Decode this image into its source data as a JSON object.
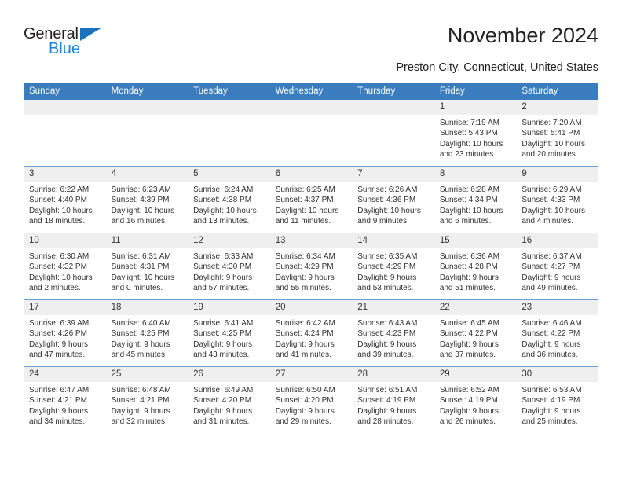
{
  "brand": {
    "name_top": "General",
    "name_bottom": "Blue",
    "color_dark": "#231f20",
    "color_blue": "#1b87dc",
    "triangle_color": "#1b74bb"
  },
  "header": {
    "title": "November 2024",
    "subtitle": "Preston City, Connecticut, United States"
  },
  "theme": {
    "header_bg": "#3a7cbe",
    "header_text": "#ffffff",
    "daynum_bg": "#efefef",
    "row_divider": "#6e9fd0",
    "body_text": "#333333"
  },
  "calendar": {
    "weekdays": [
      "Sunday",
      "Monday",
      "Tuesday",
      "Wednesday",
      "Thursday",
      "Friday",
      "Saturday"
    ],
    "weeks": [
      [
        {
          "day": "",
          "empty": true
        },
        {
          "day": "",
          "empty": true
        },
        {
          "day": "",
          "empty": true
        },
        {
          "day": "",
          "empty": true
        },
        {
          "day": "",
          "empty": true
        },
        {
          "day": "1",
          "sunrise": "Sunrise: 7:19 AM",
          "sunset": "Sunset: 5:43 PM",
          "daylight": "Daylight: 10 hours and 23 minutes."
        },
        {
          "day": "2",
          "sunrise": "Sunrise: 7:20 AM",
          "sunset": "Sunset: 5:41 PM",
          "daylight": "Daylight: 10 hours and 20 minutes."
        }
      ],
      [
        {
          "day": "3",
          "sunrise": "Sunrise: 6:22 AM",
          "sunset": "Sunset: 4:40 PM",
          "daylight": "Daylight: 10 hours and 18 minutes."
        },
        {
          "day": "4",
          "sunrise": "Sunrise: 6:23 AM",
          "sunset": "Sunset: 4:39 PM",
          "daylight": "Daylight: 10 hours and 16 minutes."
        },
        {
          "day": "5",
          "sunrise": "Sunrise: 6:24 AM",
          "sunset": "Sunset: 4:38 PM",
          "daylight": "Daylight: 10 hours and 13 minutes."
        },
        {
          "day": "6",
          "sunrise": "Sunrise: 6:25 AM",
          "sunset": "Sunset: 4:37 PM",
          "daylight": "Daylight: 10 hours and 11 minutes."
        },
        {
          "day": "7",
          "sunrise": "Sunrise: 6:26 AM",
          "sunset": "Sunset: 4:36 PM",
          "daylight": "Daylight: 10 hours and 9 minutes."
        },
        {
          "day": "8",
          "sunrise": "Sunrise: 6:28 AM",
          "sunset": "Sunset: 4:34 PM",
          "daylight": "Daylight: 10 hours and 6 minutes."
        },
        {
          "day": "9",
          "sunrise": "Sunrise: 6:29 AM",
          "sunset": "Sunset: 4:33 PM",
          "daylight": "Daylight: 10 hours and 4 minutes."
        }
      ],
      [
        {
          "day": "10",
          "sunrise": "Sunrise: 6:30 AM",
          "sunset": "Sunset: 4:32 PM",
          "daylight": "Daylight: 10 hours and 2 minutes."
        },
        {
          "day": "11",
          "sunrise": "Sunrise: 6:31 AM",
          "sunset": "Sunset: 4:31 PM",
          "daylight": "Daylight: 10 hours and 0 minutes."
        },
        {
          "day": "12",
          "sunrise": "Sunrise: 6:33 AM",
          "sunset": "Sunset: 4:30 PM",
          "daylight": "Daylight: 9 hours and 57 minutes."
        },
        {
          "day": "13",
          "sunrise": "Sunrise: 6:34 AM",
          "sunset": "Sunset: 4:29 PM",
          "daylight": "Daylight: 9 hours and 55 minutes."
        },
        {
          "day": "14",
          "sunrise": "Sunrise: 6:35 AM",
          "sunset": "Sunset: 4:29 PM",
          "daylight": "Daylight: 9 hours and 53 minutes."
        },
        {
          "day": "15",
          "sunrise": "Sunrise: 6:36 AM",
          "sunset": "Sunset: 4:28 PM",
          "daylight": "Daylight: 9 hours and 51 minutes."
        },
        {
          "day": "16",
          "sunrise": "Sunrise: 6:37 AM",
          "sunset": "Sunset: 4:27 PM",
          "daylight": "Daylight: 9 hours and 49 minutes."
        }
      ],
      [
        {
          "day": "17",
          "sunrise": "Sunrise: 6:39 AM",
          "sunset": "Sunset: 4:26 PM",
          "daylight": "Daylight: 9 hours and 47 minutes."
        },
        {
          "day": "18",
          "sunrise": "Sunrise: 6:40 AM",
          "sunset": "Sunset: 4:25 PM",
          "daylight": "Daylight: 9 hours and 45 minutes."
        },
        {
          "day": "19",
          "sunrise": "Sunrise: 6:41 AM",
          "sunset": "Sunset: 4:25 PM",
          "daylight": "Daylight: 9 hours and 43 minutes."
        },
        {
          "day": "20",
          "sunrise": "Sunrise: 6:42 AM",
          "sunset": "Sunset: 4:24 PM",
          "daylight": "Daylight: 9 hours and 41 minutes."
        },
        {
          "day": "21",
          "sunrise": "Sunrise: 6:43 AM",
          "sunset": "Sunset: 4:23 PM",
          "daylight": "Daylight: 9 hours and 39 minutes."
        },
        {
          "day": "22",
          "sunrise": "Sunrise: 6:45 AM",
          "sunset": "Sunset: 4:22 PM",
          "daylight": "Daylight: 9 hours and 37 minutes."
        },
        {
          "day": "23",
          "sunrise": "Sunrise: 6:46 AM",
          "sunset": "Sunset: 4:22 PM",
          "daylight": "Daylight: 9 hours and 36 minutes."
        }
      ],
      [
        {
          "day": "24",
          "sunrise": "Sunrise: 6:47 AM",
          "sunset": "Sunset: 4:21 PM",
          "daylight": "Daylight: 9 hours and 34 minutes."
        },
        {
          "day": "25",
          "sunrise": "Sunrise: 6:48 AM",
          "sunset": "Sunset: 4:21 PM",
          "daylight": "Daylight: 9 hours and 32 minutes."
        },
        {
          "day": "26",
          "sunrise": "Sunrise: 6:49 AM",
          "sunset": "Sunset: 4:20 PM",
          "daylight": "Daylight: 9 hours and 31 minutes."
        },
        {
          "day": "27",
          "sunrise": "Sunrise: 6:50 AM",
          "sunset": "Sunset: 4:20 PM",
          "daylight": "Daylight: 9 hours and 29 minutes."
        },
        {
          "day": "28",
          "sunrise": "Sunrise: 6:51 AM",
          "sunset": "Sunset: 4:19 PM",
          "daylight": "Daylight: 9 hours and 28 minutes."
        },
        {
          "day": "29",
          "sunrise": "Sunrise: 6:52 AM",
          "sunset": "Sunset: 4:19 PM",
          "daylight": "Daylight: 9 hours and 26 minutes."
        },
        {
          "day": "30",
          "sunrise": "Sunrise: 6:53 AM",
          "sunset": "Sunset: 4:19 PM",
          "daylight": "Daylight: 9 hours and 25 minutes."
        }
      ]
    ]
  }
}
